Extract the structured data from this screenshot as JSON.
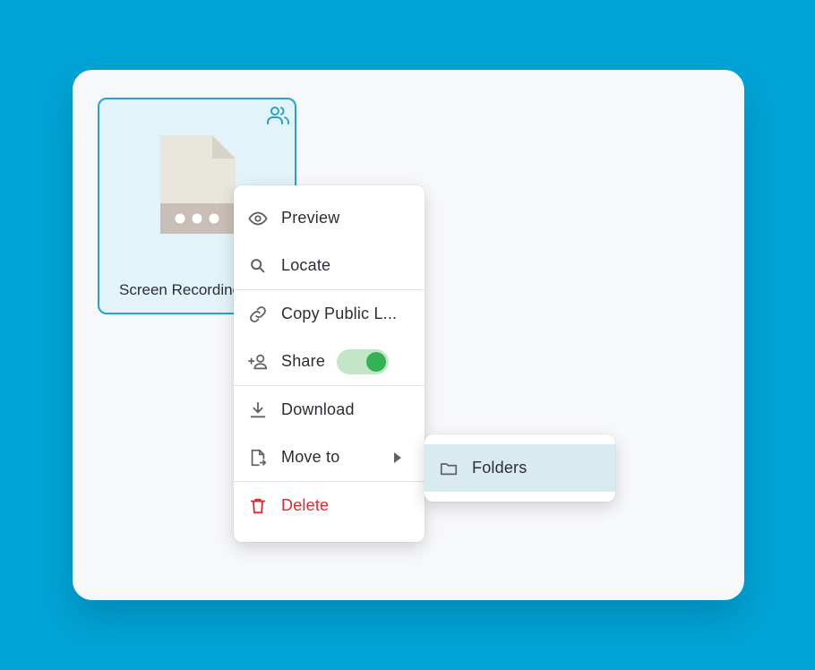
{
  "colors": {
    "background": "#00a5d6",
    "accent": "#29a3cc",
    "toggle_on": "#33b454",
    "danger": "#e0282f"
  },
  "file": {
    "name": "Screen Recording",
    "icon": "file-icon",
    "badge_icon": "shared-users-icon"
  },
  "menu": {
    "items": [
      {
        "label": "Preview",
        "icon": "eye-icon"
      },
      {
        "label": "Locate",
        "icon": "search-icon"
      },
      {
        "label": "Copy Public L...",
        "icon": "link-icon"
      },
      {
        "label": "Share",
        "icon": "add-user-icon",
        "toggle_on": true
      },
      {
        "label": "Download",
        "icon": "download-icon"
      },
      {
        "label": "Move to",
        "icon": "move-file-icon"
      },
      {
        "label": "Delete",
        "icon": "trash-icon"
      }
    ]
  },
  "submenu": {
    "items": [
      {
        "label": "Folders",
        "icon": "folder-icon"
      }
    ]
  }
}
